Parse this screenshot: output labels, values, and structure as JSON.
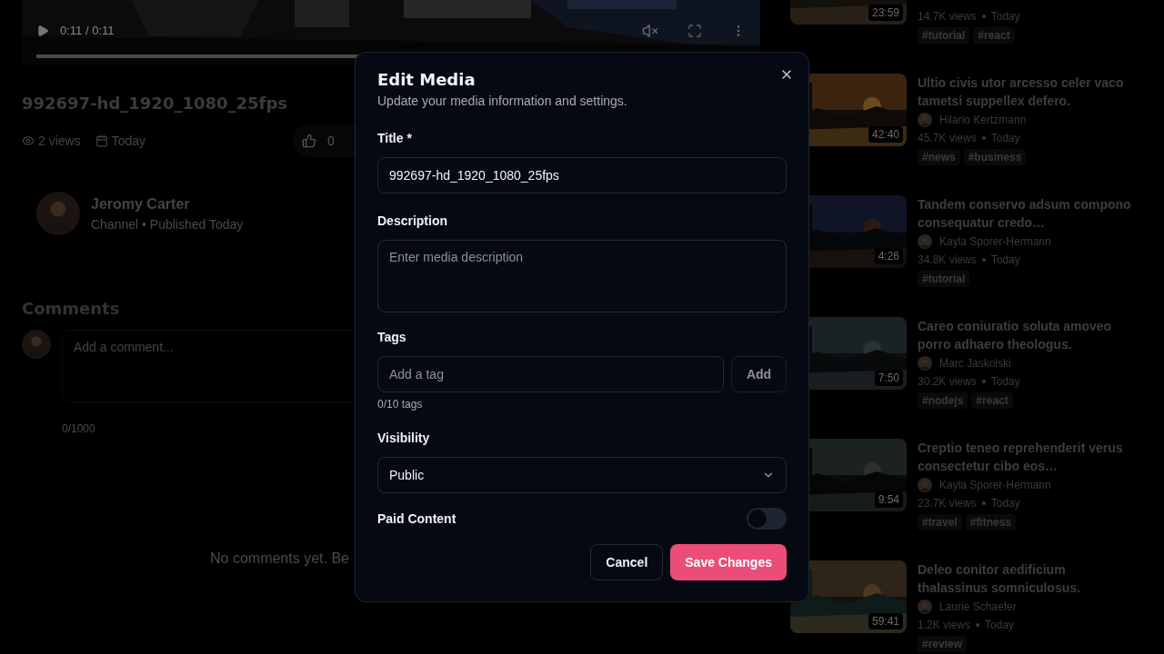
{
  "player": {
    "time": "0:11 / 0:11",
    "level": 1,
    "muted": true
  },
  "video": {
    "title": "992697-hd_1920_1080_25fps",
    "views": "2 views",
    "date": "Today",
    "likes": "0"
  },
  "channel": {
    "name": "Jeromy Carter",
    "subtitle": "Channel • Published Today"
  },
  "comments": {
    "heading": "Comments",
    "placeholder": "Add a comment...",
    "counter": "0/1000",
    "empty": "No comments yet. Be"
  },
  "recommendations": [
    {
      "duration": "23:59",
      "views": "14.7K views",
      "date": "Today",
      "tags": [
        "#tutorial",
        "#react"
      ]
    },
    {
      "title": "Ultio civis utor arcesso celer vaco tametsi suppellex defero.",
      "author": "Hilario Kertzmann",
      "duration": "42:40",
      "views": "45.7K views",
      "date": "Today",
      "tags": [
        "#news",
        "#business"
      ]
    },
    {
      "title": "Tandem conservo adsum compono consequatur credo…",
      "author": "Kayla Sporer-Hermann",
      "duration": "4:26",
      "views": "34.8K views",
      "date": "Today",
      "tags": [
        "#tutorial"
      ]
    },
    {
      "title": "Careo coniuratio soluta amoveo porro adhaero theologus.",
      "author": "Marc Jaskolski",
      "duration": "7:50",
      "views": "30.2K views",
      "date": "Today",
      "tags": [
        "#nodejs",
        "#react"
      ]
    },
    {
      "title": "Creptio teneo reprehenderit verus consectetur cibo eos…",
      "author": "Kayla Sporer-Hermann",
      "duration": "9:54",
      "views": "23.7K views",
      "date": "Today",
      "tags": [
        "#travel",
        "#fitness"
      ]
    },
    {
      "title": "Deleo conitor aedificium thalassinus somniculosus.",
      "author": "Laurie Schaefer",
      "duration": "59:41",
      "views": "1.2K views",
      "date": "Today",
      "tags": [
        "#review"
      ]
    }
  ],
  "dialog": {
    "title": "Edit Media",
    "subtitle": "Update your media information and settings.",
    "title_label": "Title *",
    "title_value": "992697-hd_1920_1080_25fps",
    "description_label": "Description",
    "description_placeholder": "Enter media description",
    "tags_label": "Tags",
    "tags_placeholder": "Add a tag",
    "add_button": "Add",
    "tags_count": "0/10 tags",
    "visibility_label": "Visibility",
    "visibility_value": "Public",
    "paid_label": "Paid Content",
    "paid_on": false,
    "cancel_button": "Cancel",
    "save_button": "Save Changes"
  }
}
